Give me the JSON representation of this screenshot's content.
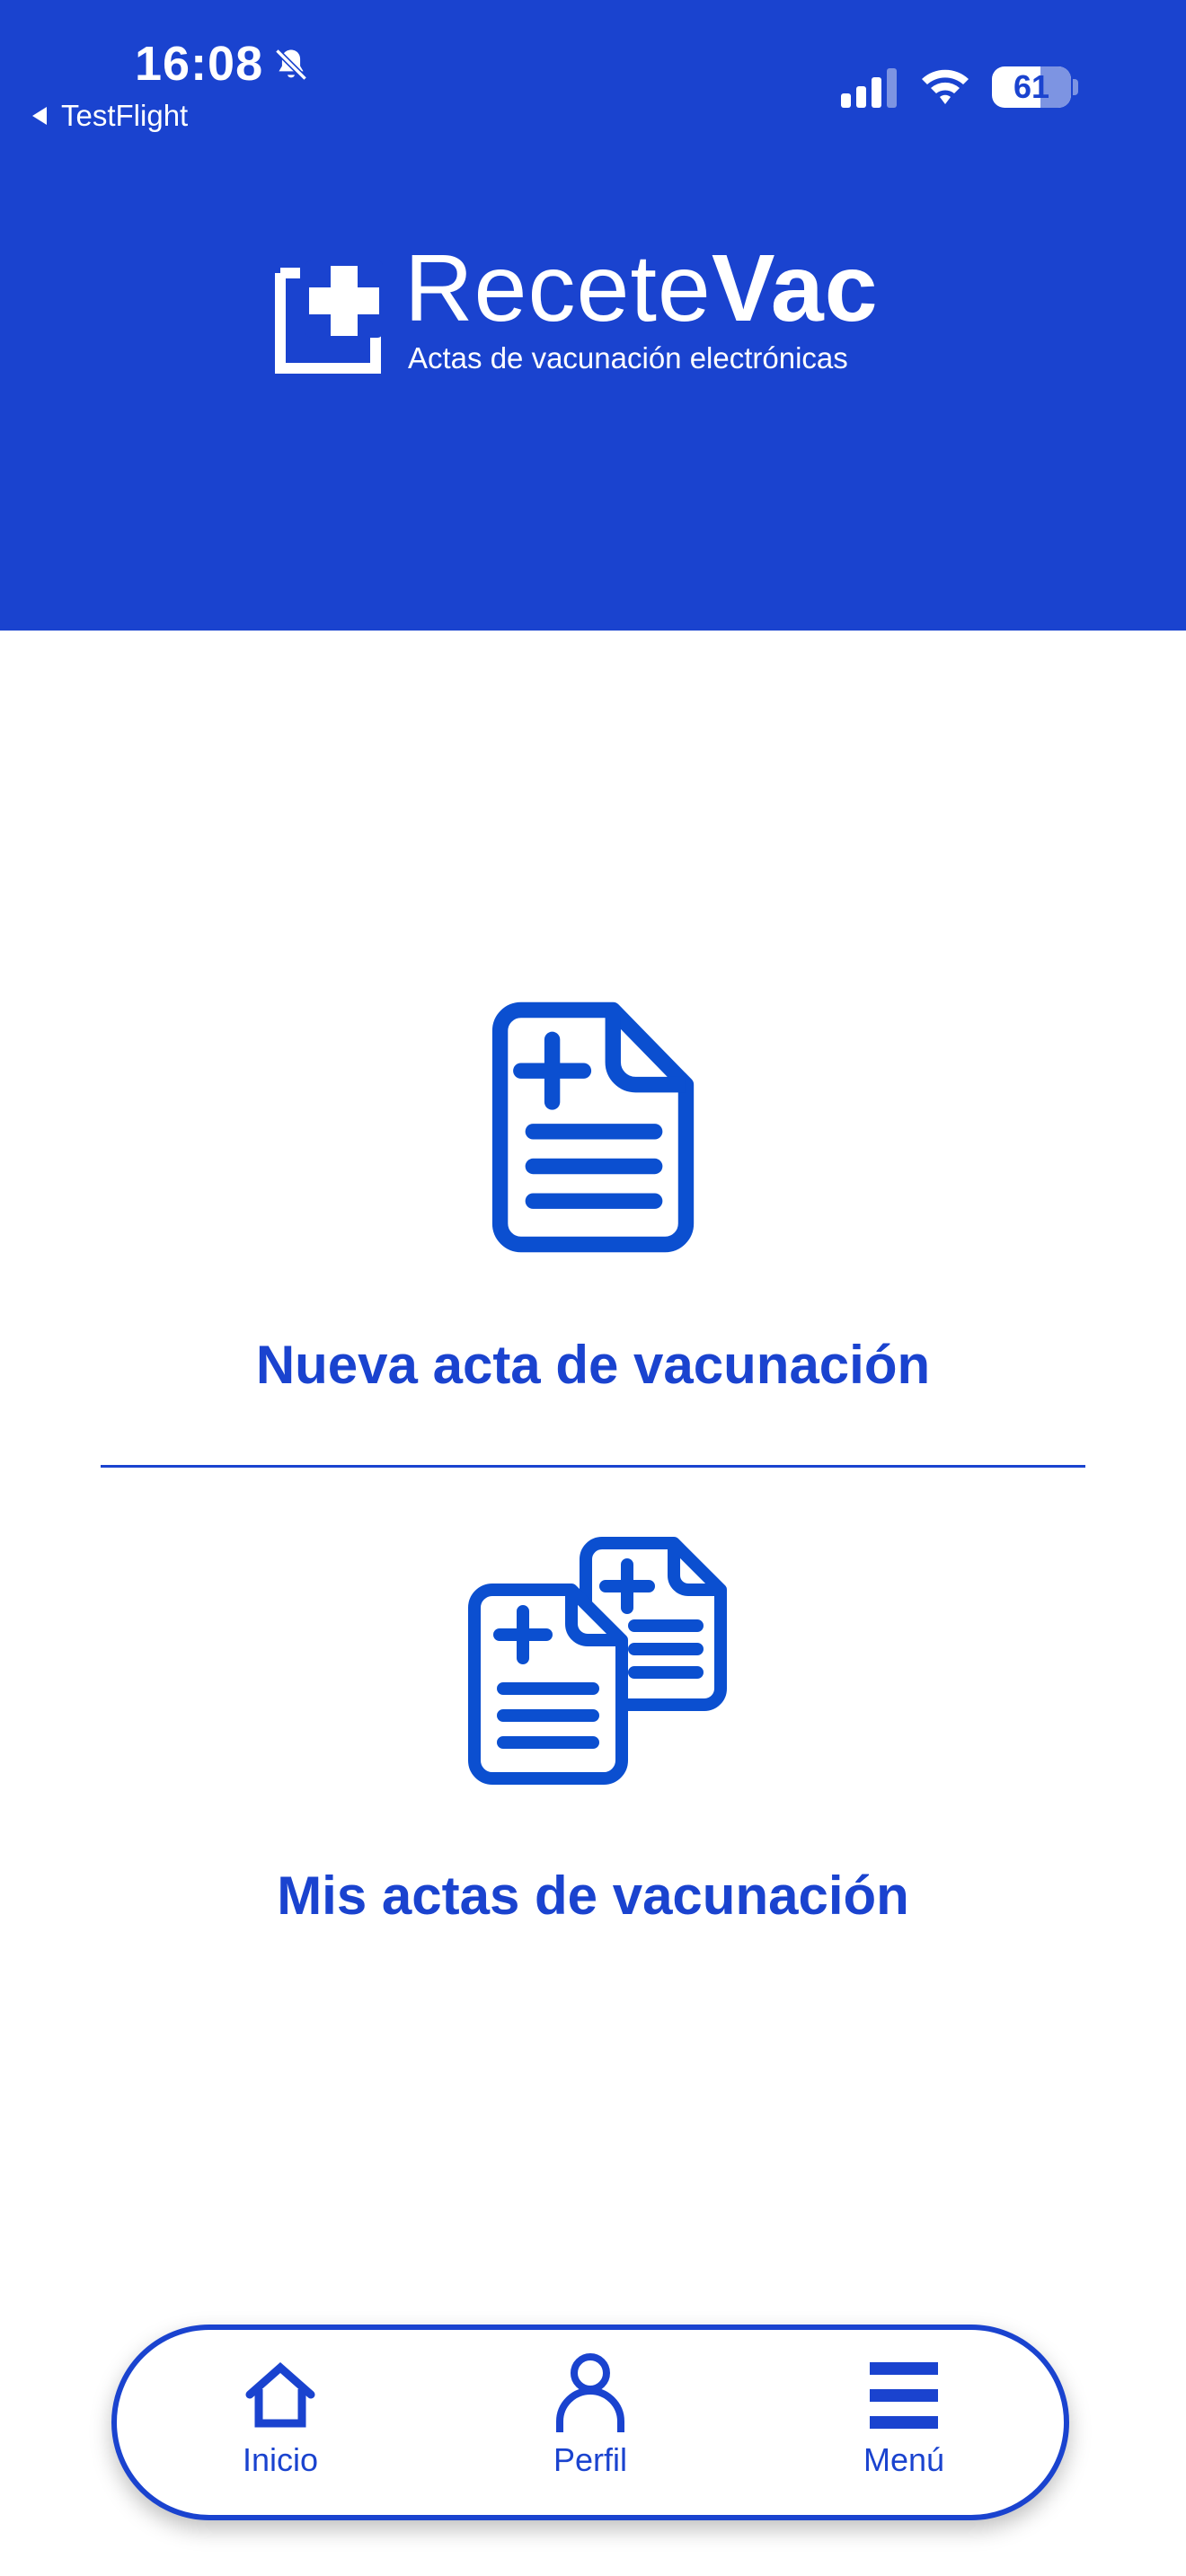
{
  "status_bar": {
    "time": "16:08",
    "back_app": "TestFlight",
    "battery_level": "61"
  },
  "header": {
    "logo": {
      "name_regular": "Recete",
      "name_bold": "Vac",
      "tagline": "Actas de vacunación electrónicas"
    }
  },
  "actions": {
    "new": {
      "label": "Nueva acta de vacunación",
      "icon": "document-plus-icon"
    },
    "mine": {
      "label": "Mis actas de vacunación",
      "icon": "documents-plus-icon"
    }
  },
  "tab_bar": {
    "items": [
      {
        "label": "Inicio",
        "icon": "home-icon"
      },
      {
        "label": "Perfil",
        "icon": "user-icon"
      },
      {
        "label": "Menú",
        "icon": "menu-icon"
      }
    ]
  },
  "colors": {
    "brand_blue": "#1a43cf",
    "white": "#ffffff"
  }
}
